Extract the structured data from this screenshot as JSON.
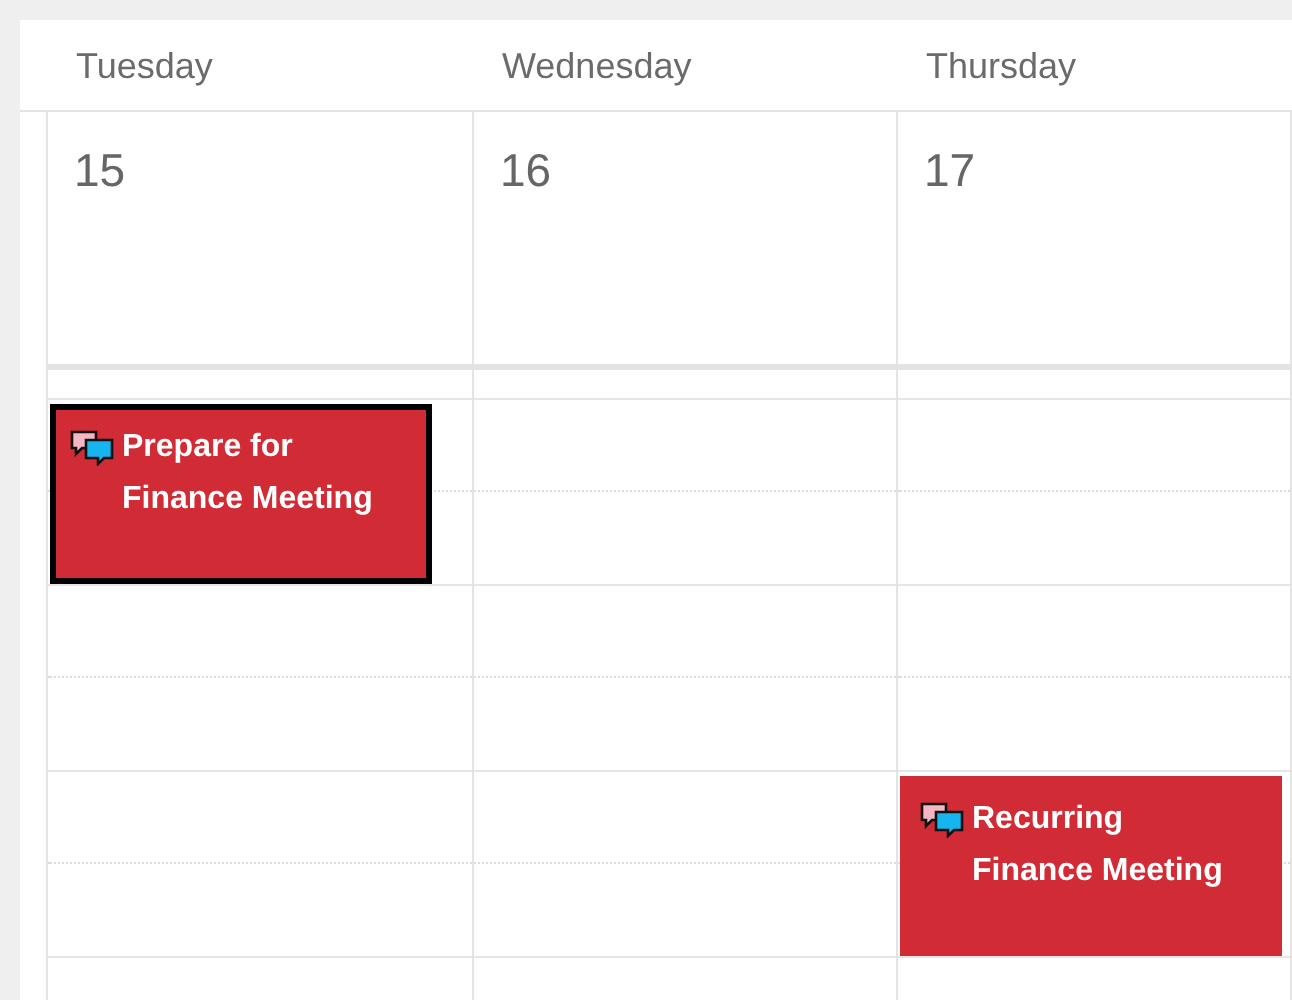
{
  "days": [
    {
      "name": "Tuesday",
      "date": "15"
    },
    {
      "name": "Wednesday",
      "date": "16"
    },
    {
      "name": "Thursday",
      "date": "17"
    }
  ],
  "events": [
    {
      "title": "Prepare for Finance Meeting",
      "selected": true
    },
    {
      "title": "Recurring Finance Meeting",
      "selected": false
    }
  ]
}
